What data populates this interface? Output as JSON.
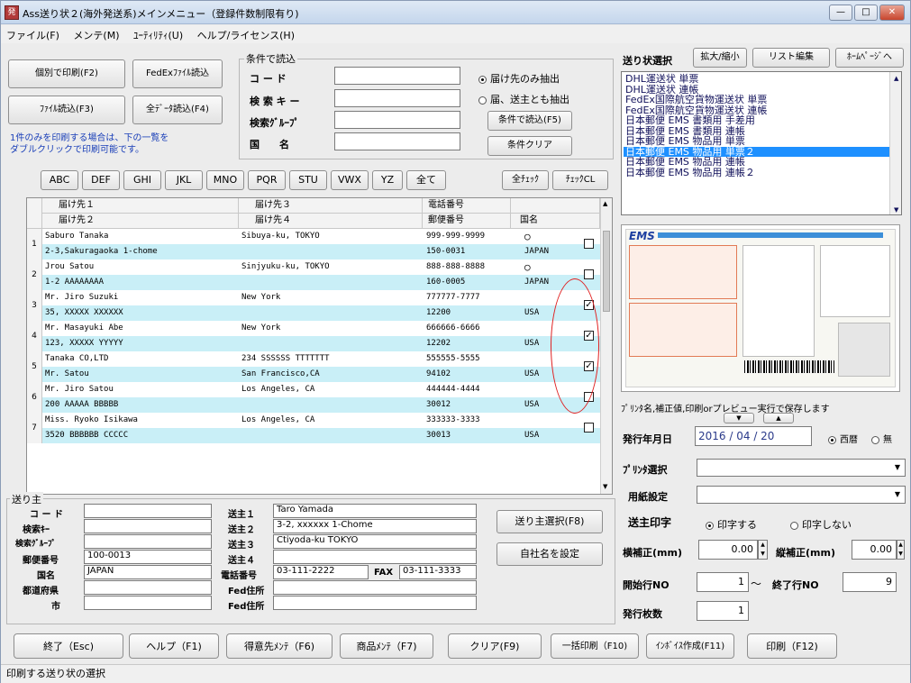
{
  "window": {
    "title": "Ass送り状２(海外発送系)メインメニュー（登録件数制限有り)",
    "app_icon": "発",
    "min_btn": "—",
    "max_btn": "□",
    "close_btn": "✕"
  },
  "menu": [
    "ファイル(F)",
    "メンテ(M)",
    "ﾕｰﾃｨﾘﾃｨ(U)",
    "ヘルプ/ライセンス(H)"
  ],
  "top_buttons": {
    "kobetsu_print": "個別で印刷(F2)",
    "fedex_read": "FedExﾌｧｲﾙ読込",
    "file_read": "ﾌｧｲﾙ読込(F3)",
    "all_data_read": "全ﾃﾞｰﾀ読込(F4)"
  },
  "hint_text": [
    "1件のみを印刷する場合は、下の一覧を",
    "ダブルクリックで印刷可能です。"
  ],
  "condition": {
    "group_title": "条件で読込",
    "code_label": "コ ー ド",
    "search_key_label": "検 索 キ ー",
    "search_group_label": "検索ｸﾞﾙｰﾌﾟ",
    "country_label": "国　　名",
    "code_value": "",
    "search_key_value": "",
    "search_group_value": "",
    "country_value": "",
    "radio_dest_only": "届け先のみ抽出",
    "radio_both": "届、送主とも抽出",
    "read_button": "条件で読込(F5)",
    "clear_button": "条件クリア"
  },
  "alpha_buttons": [
    "ABC",
    "DEF",
    "GHI",
    "JKL",
    "MNO",
    "PQR",
    "STU",
    "VWX",
    "YZ",
    "全て"
  ],
  "check_all": "全ﾁｪｯｸ",
  "check_clear": "ﾁｪｯｸCL",
  "grid": {
    "headers_top": [
      "届け先１",
      "届け先３",
      "電話番号",
      ""
    ],
    "headers_bottom": [
      "届け先２",
      "届け先４",
      "郵便番号",
      "国名"
    ],
    "rows": [
      {
        "num": "1",
        "a1": "Saburo Tanaka",
        "a3": "Sibuya-ku, TOKYO",
        "tel": "999-999-9999",
        "mark": "○",
        "a2": "2-3,Sakuragaoka 1-chome",
        "a4": "",
        "zip": "150-0031",
        "country": "JAPAN",
        "checked": false
      },
      {
        "num": "2",
        "a1": "Jrou Satou",
        "a3": "Sinjyuku-ku, TOKYO",
        "tel": "888-888-8888",
        "mark": "○",
        "a2": "1-2 AAAAAAAA",
        "a4": "",
        "zip": "160-0005",
        "country": "JAPAN",
        "checked": false
      },
      {
        "num": "3",
        "a1": "Mr. Jiro Suzuki",
        "a3": "New York",
        "tel": "777777-7777",
        "mark": "",
        "a2": "35, XXXXX XXXXXX",
        "a4": "",
        "zip": "12200",
        "country": "USA",
        "checked": true
      },
      {
        "num": "4",
        "a1": "Mr. Masayuki Abe",
        "a3": "New York",
        "tel": "666666-6666",
        "mark": "",
        "a2": "123, XXXXX YYYYY",
        "a4": "",
        "zip": "12202",
        "country": "USA",
        "checked": true
      },
      {
        "num": "5",
        "a1": "Tanaka CO,LTD",
        "a3": "234 SSSSSS TTTTTTT",
        "tel": "555555-5555",
        "mark": "",
        "a2": "Mr. Satou",
        "a4": "San Francisco,CA",
        "zip": "94102",
        "country": "USA",
        "checked": true
      },
      {
        "num": "6",
        "a1": "Mr. Jiro Satou",
        "a3": "Los Angeles, CA",
        "tel": "444444-4444",
        "mark": "",
        "a2": "200 AAAAA BBBBB",
        "a4": "",
        "zip": "30012",
        "country": "USA",
        "checked": false
      },
      {
        "num": "7",
        "a1": "Miss. Ryoko Isikawa",
        "a3": "Los Angeles, CA",
        "tel": "333333-3333",
        "mark": "",
        "a2": "3520 BBBBBB CCCCC",
        "a4": "",
        "zip": "30013",
        "country": "USA",
        "checked": false
      }
    ]
  },
  "sender": {
    "group_title": "送り主",
    "code_label": "コ ー ド",
    "code_value": "",
    "search_key_label": "検索ｷｰ",
    "search_key_value": "",
    "search_group_label": "検索ｸﾞﾙｰﾌﾟ",
    "search_group_value": "",
    "zip_label": "郵便番号",
    "zip_value": "100-0013",
    "country_label": "国名",
    "country_value": "JAPAN",
    "pref_label": "都道府県",
    "pref_value": "",
    "city_label": "市",
    "city_value": "",
    "s1_label": "送主１",
    "s1_value": "Taro Yamada",
    "s2_label": "送主２",
    "s2_value": "3-2, xxxxxx 1-Chome",
    "s3_label": "送主３",
    "s3_value": "Ctiyoda-ku TOKYO",
    "s4_label": "送主４",
    "s4_value": "",
    "tel_label": "電話番号",
    "tel_value": "03-111-2222",
    "fax_label": "FAX",
    "fax_value": "03-111-3333",
    "fed1_label": "Fed住所",
    "fed1_value": "",
    "fed2_label": "Fed住所",
    "fed2_value": "",
    "select_button": "送り主選択(F8)",
    "company_button": "自社名を設定"
  },
  "right": {
    "select_label": "送り状選択",
    "zoom_button": "拡大/縮小",
    "list_edit_button": "リスト編集",
    "homepage_button": "ﾎｰﾑﾍﾟｰｼﾞへ",
    "list": [
      "DHL運送状 単票",
      "DHL運送状 連帳",
      "FedEx国際航空貨物運送状 単票",
      "FedEx国際航空貨物運送状 連帳",
      "日本郵便 EMS 書類用 手差用",
      "日本郵便 EMS 書類用 連帳",
      "日本郵便 EMS 物品用 単票",
      "日本郵便 EMS 物品用 単票２",
      "日本郵便 EMS 物品用 連帳",
      "日本郵便 EMS 物品用 連帳２"
    ],
    "selected_index": 7,
    "preview_logo": "EMS",
    "preview_caption": "ﾌﾟﾘﾝﾀ名,補正値,印刷orプレビュー実行で保存します",
    "date_label": "発行年月日",
    "date_year": "2016",
    "date_month": "04",
    "date_day": "20",
    "era_seireki": "西暦",
    "era_none": "無",
    "printer_label": "ﾌﾟﾘﾝﾀ選択",
    "printer_value": "",
    "paper_label": "用紙設定",
    "paper_value": "",
    "sender_print_label": "送主印字",
    "print_yes": "印字する",
    "print_no": "印字しない",
    "h_adjust_label": "横補正(mm)",
    "h_adjust_value": "0.00",
    "v_adjust_label": "縦補正(mm)",
    "v_adjust_value": "0.00",
    "start_row_label": "開始行NO",
    "start_row_value": "1",
    "tilde": "～",
    "end_row_label": "終了行NO",
    "end_row_value": "9",
    "copies_label": "発行枚数",
    "copies_value": "1"
  },
  "bottom_buttons": [
    "終了（Esc)",
    "ヘルプ（F1)",
    "得意先ﾒﾝﾃ（F6)",
    "商品ﾒﾝﾃ（F7)",
    "クリア(F9)",
    "一括印刷（F10)",
    "ｲﾝﾎﾞｲｽ作成(F11)",
    "印刷（F12)"
  ],
  "status_text": "印刷する送り状の選択"
}
